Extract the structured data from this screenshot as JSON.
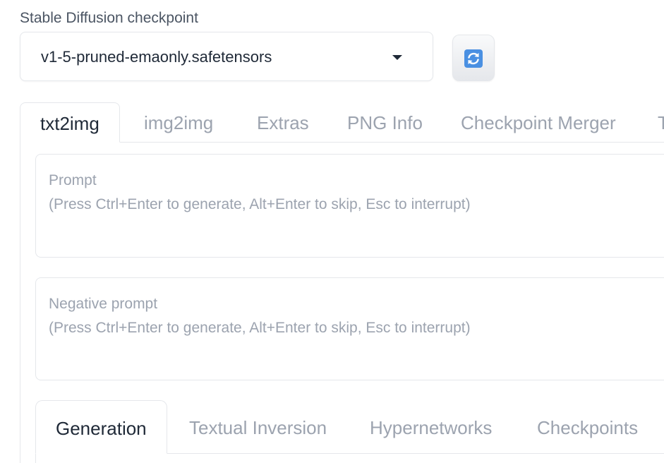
{
  "checkpoint": {
    "label": "Stable Diffusion checkpoint",
    "selected": "v1-5-pruned-emaonly.safetensors",
    "refresh_icon": "refresh-icon",
    "accent_color": "#4a90e2"
  },
  "main_tabs": [
    {
      "label": "txt2img",
      "active": true
    },
    {
      "label": "img2img",
      "active": false
    },
    {
      "label": "Extras",
      "active": false
    },
    {
      "label": "PNG Info",
      "active": false
    },
    {
      "label": "Checkpoint Merger",
      "active": false
    },
    {
      "label": "T",
      "active": false
    }
  ],
  "prompt": {
    "placeholder": "Prompt\n(Press Ctrl+Enter to generate, Alt+Enter to skip, Esc to interrupt)",
    "value": ""
  },
  "negative_prompt": {
    "placeholder": "Negative prompt\n(Press Ctrl+Enter to generate, Alt+Enter to skip, Esc to interrupt)",
    "value": ""
  },
  "sub_tabs": [
    {
      "label": "Generation",
      "active": true
    },
    {
      "label": "Textual Inversion",
      "active": false
    },
    {
      "label": "Hypernetworks",
      "active": false
    },
    {
      "label": "Checkpoints",
      "active": false
    }
  ]
}
